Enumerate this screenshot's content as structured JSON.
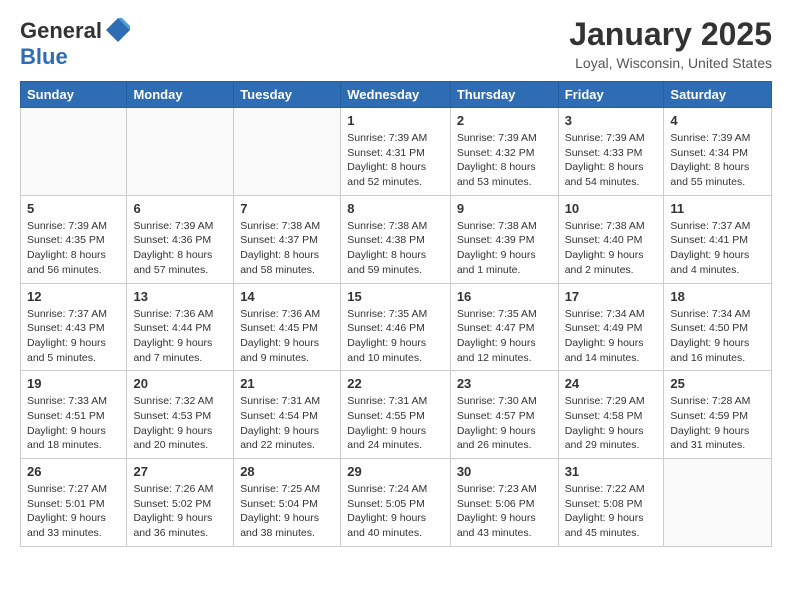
{
  "header": {
    "logo_general": "General",
    "logo_blue": "Blue",
    "month_title": "January 2025",
    "location": "Loyal, Wisconsin, United States"
  },
  "weekdays": [
    "Sunday",
    "Monday",
    "Tuesday",
    "Wednesday",
    "Thursday",
    "Friday",
    "Saturday"
  ],
  "weeks": [
    [
      {
        "day": "",
        "info": "",
        "empty": true
      },
      {
        "day": "",
        "info": "",
        "empty": true
      },
      {
        "day": "",
        "info": "",
        "empty": true
      },
      {
        "day": "1",
        "info": "Sunrise: 7:39 AM\nSunset: 4:31 PM\nDaylight: 8 hours and 52 minutes."
      },
      {
        "day": "2",
        "info": "Sunrise: 7:39 AM\nSunset: 4:32 PM\nDaylight: 8 hours and 53 minutes."
      },
      {
        "day": "3",
        "info": "Sunrise: 7:39 AM\nSunset: 4:33 PM\nDaylight: 8 hours and 54 minutes."
      },
      {
        "day": "4",
        "info": "Sunrise: 7:39 AM\nSunset: 4:34 PM\nDaylight: 8 hours and 55 minutes."
      }
    ],
    [
      {
        "day": "5",
        "info": "Sunrise: 7:39 AM\nSunset: 4:35 PM\nDaylight: 8 hours and 56 minutes."
      },
      {
        "day": "6",
        "info": "Sunrise: 7:39 AM\nSunset: 4:36 PM\nDaylight: 8 hours and 57 minutes."
      },
      {
        "day": "7",
        "info": "Sunrise: 7:38 AM\nSunset: 4:37 PM\nDaylight: 8 hours and 58 minutes."
      },
      {
        "day": "8",
        "info": "Sunrise: 7:38 AM\nSunset: 4:38 PM\nDaylight: 8 hours and 59 minutes."
      },
      {
        "day": "9",
        "info": "Sunrise: 7:38 AM\nSunset: 4:39 PM\nDaylight: 9 hours and 1 minute."
      },
      {
        "day": "10",
        "info": "Sunrise: 7:38 AM\nSunset: 4:40 PM\nDaylight: 9 hours and 2 minutes."
      },
      {
        "day": "11",
        "info": "Sunrise: 7:37 AM\nSunset: 4:41 PM\nDaylight: 9 hours and 4 minutes."
      }
    ],
    [
      {
        "day": "12",
        "info": "Sunrise: 7:37 AM\nSunset: 4:43 PM\nDaylight: 9 hours and 5 minutes."
      },
      {
        "day": "13",
        "info": "Sunrise: 7:36 AM\nSunset: 4:44 PM\nDaylight: 9 hours and 7 minutes."
      },
      {
        "day": "14",
        "info": "Sunrise: 7:36 AM\nSunset: 4:45 PM\nDaylight: 9 hours and 9 minutes."
      },
      {
        "day": "15",
        "info": "Sunrise: 7:35 AM\nSunset: 4:46 PM\nDaylight: 9 hours and 10 minutes."
      },
      {
        "day": "16",
        "info": "Sunrise: 7:35 AM\nSunset: 4:47 PM\nDaylight: 9 hours and 12 minutes."
      },
      {
        "day": "17",
        "info": "Sunrise: 7:34 AM\nSunset: 4:49 PM\nDaylight: 9 hours and 14 minutes."
      },
      {
        "day": "18",
        "info": "Sunrise: 7:34 AM\nSunset: 4:50 PM\nDaylight: 9 hours and 16 minutes."
      }
    ],
    [
      {
        "day": "19",
        "info": "Sunrise: 7:33 AM\nSunset: 4:51 PM\nDaylight: 9 hours and 18 minutes."
      },
      {
        "day": "20",
        "info": "Sunrise: 7:32 AM\nSunset: 4:53 PM\nDaylight: 9 hours and 20 minutes."
      },
      {
        "day": "21",
        "info": "Sunrise: 7:31 AM\nSunset: 4:54 PM\nDaylight: 9 hours and 22 minutes."
      },
      {
        "day": "22",
        "info": "Sunrise: 7:31 AM\nSunset: 4:55 PM\nDaylight: 9 hours and 24 minutes."
      },
      {
        "day": "23",
        "info": "Sunrise: 7:30 AM\nSunset: 4:57 PM\nDaylight: 9 hours and 26 minutes."
      },
      {
        "day": "24",
        "info": "Sunrise: 7:29 AM\nSunset: 4:58 PM\nDaylight: 9 hours and 29 minutes."
      },
      {
        "day": "25",
        "info": "Sunrise: 7:28 AM\nSunset: 4:59 PM\nDaylight: 9 hours and 31 minutes."
      }
    ],
    [
      {
        "day": "26",
        "info": "Sunrise: 7:27 AM\nSunset: 5:01 PM\nDaylight: 9 hours and 33 minutes."
      },
      {
        "day": "27",
        "info": "Sunrise: 7:26 AM\nSunset: 5:02 PM\nDaylight: 9 hours and 36 minutes."
      },
      {
        "day": "28",
        "info": "Sunrise: 7:25 AM\nSunset: 5:04 PM\nDaylight: 9 hours and 38 minutes."
      },
      {
        "day": "29",
        "info": "Sunrise: 7:24 AM\nSunset: 5:05 PM\nDaylight: 9 hours and 40 minutes."
      },
      {
        "day": "30",
        "info": "Sunrise: 7:23 AM\nSunset: 5:06 PM\nDaylight: 9 hours and 43 minutes."
      },
      {
        "day": "31",
        "info": "Sunrise: 7:22 AM\nSunset: 5:08 PM\nDaylight: 9 hours and 45 minutes."
      },
      {
        "day": "",
        "info": "",
        "empty": true,
        "shaded": true
      }
    ]
  ]
}
